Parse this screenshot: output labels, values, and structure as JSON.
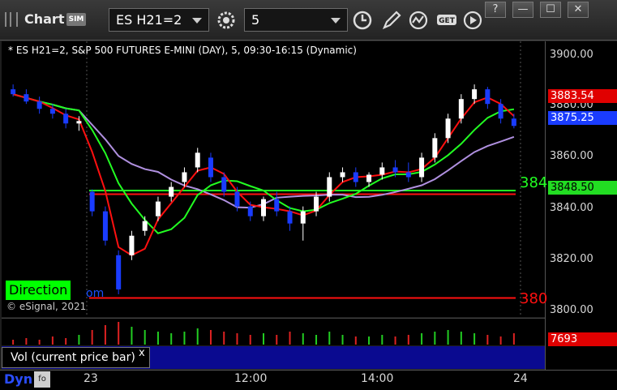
{
  "toolbar": {
    "app_title": "Chart",
    "sim_badge": "SIM",
    "symbol": "ES H21=2",
    "interval": "5",
    "window_buttons": [
      "?",
      "—",
      "☐",
      "✕"
    ]
  },
  "chart": {
    "header": "* ES H21=2, S&P 500 FUTURES E-MINI (DAY), 5, 09:30-16:15 (Dynamic)",
    "copyright": "© eSignal, 2021",
    "direction_label": "Direction",
    "direction_suffix": "om",
    "price_ticks": [
      "3900.00",
      "3880.00",
      "3860.00",
      "3840.00",
      "3820.00",
      "3800.00"
    ],
    "price_tags": {
      "red": "3883.54",
      "blue": "3875.25",
      "green": "3848.50"
    },
    "side_labels": {
      "green": "384",
      "red": "380"
    },
    "colors": {
      "up_candle": "#ffffff",
      "down_candle": "#1a3cff",
      "ma_red": "#ff1010",
      "ma_green": "#22ff22",
      "ma_purple": "#b090e0",
      "level_green": "#22ff22",
      "level_red": "#ff1010",
      "volume_bg": "#0a0a90"
    }
  },
  "chart_data": {
    "type": "candlestick",
    "ylim": [
      3800,
      3905
    ],
    "yticks": [
      3900,
      3880,
      3860,
      3840,
      3820,
      3800
    ],
    "xticks": [
      "23",
      "12:00",
      "14:00",
      "24"
    ],
    "levels": [
      {
        "value": 3848.5,
        "color": "green"
      },
      {
        "value": 3847.0,
        "color": "red"
      },
      {
        "value": 3804.5,
        "color": "red"
      }
    ],
    "candles": [
      {
        "o": 3890,
        "h": 3892,
        "l": 3887,
        "c": 3888
      },
      {
        "o": 3888,
        "h": 3890,
        "l": 3884,
        "c": 3885
      },
      {
        "o": 3885,
        "h": 3887,
        "l": 3880,
        "c": 3882
      },
      {
        "o": 3882,
        "h": 3884,
        "l": 3878,
        "c": 3880
      },
      {
        "o": 3880,
        "h": 3882,
        "l": 3874,
        "c": 3876
      },
      {
        "o": 3876,
        "h": 3879,
        "l": 3873,
        "c": 3877
      },
      {
        "o": 3848,
        "h": 3849,
        "l": 3838,
        "c": 3840
      },
      {
        "o": 3840,
        "h": 3842,
        "l": 3826,
        "c": 3828
      },
      {
        "o": 3822,
        "h": 3824,
        "l": 3806,
        "c": 3808
      },
      {
        "o": 3822,
        "h": 3832,
        "l": 3820,
        "c": 3830
      },
      {
        "o": 3832,
        "h": 3838,
        "l": 3830,
        "c": 3836
      },
      {
        "o": 3838,
        "h": 3846,
        "l": 3836,
        "c": 3844
      },
      {
        "o": 3846,
        "h": 3852,
        "l": 3844,
        "c": 3850
      },
      {
        "o": 3852,
        "h": 3858,
        "l": 3850,
        "c": 3856
      },
      {
        "o": 3858,
        "h": 3866,
        "l": 3856,
        "c": 3864
      },
      {
        "o": 3862,
        "h": 3864,
        "l": 3852,
        "c": 3854
      },
      {
        "o": 3854,
        "h": 3856,
        "l": 3846,
        "c": 3848
      },
      {
        "o": 3848,
        "h": 3850,
        "l": 3840,
        "c": 3842
      },
      {
        "o": 3842,
        "h": 3844,
        "l": 3836,
        "c": 3838
      },
      {
        "o": 3838,
        "h": 3846,
        "l": 3836,
        "c": 3845
      },
      {
        "o": 3845,
        "h": 3848,
        "l": 3838,
        "c": 3840
      },
      {
        "o": 3840,
        "h": 3842,
        "l": 3832,
        "c": 3835
      },
      {
        "o": 3835,
        "h": 3842,
        "l": 3828,
        "c": 3840
      },
      {
        "o": 3840,
        "h": 3848,
        "l": 3838,
        "c": 3846
      },
      {
        "o": 3846,
        "h": 3856,
        "l": 3844,
        "c": 3854
      },
      {
        "o": 3854,
        "h": 3858,
        "l": 3852,
        "c": 3856
      },
      {
        "o": 3856,
        "h": 3858,
        "l": 3850,
        "c": 3852
      },
      {
        "o": 3852,
        "h": 3856,
        "l": 3850,
        "c": 3855
      },
      {
        "o": 3855,
        "h": 3860,
        "l": 3853,
        "c": 3858
      },
      {
        "o": 3858,
        "h": 3861,
        "l": 3854,
        "c": 3856
      },
      {
        "o": 3856,
        "h": 3860,
        "l": 3852,
        "c": 3854
      },
      {
        "o": 3854,
        "h": 3864,
        "l": 3852,
        "c": 3862
      },
      {
        "o": 3862,
        "h": 3872,
        "l": 3860,
        "c": 3870
      },
      {
        "o": 3870,
        "h": 3880,
        "l": 3868,
        "c": 3878
      },
      {
        "o": 3878,
        "h": 3888,
        "l": 3876,
        "c": 3886
      },
      {
        "o": 3886,
        "h": 3892,
        "l": 3884,
        "c": 3890
      },
      {
        "o": 3890,
        "h": 3891,
        "l": 3882,
        "c": 3884
      },
      {
        "o": 3884,
        "h": 3886,
        "l": 3876,
        "c": 3878
      },
      {
        "o": 3878,
        "h": 3880,
        "l": 3874,
        "c": 3875
      }
    ],
    "volume": [
      3,
      4,
      3,
      5,
      4,
      6,
      9,
      12,
      14,
      11,
      9,
      8,
      7,
      8,
      10,
      9,
      8,
      7,
      6,
      7,
      6,
      8,
      7,
      6,
      8,
      6,
      5,
      5,
      6,
      5,
      6,
      7,
      8,
      9,
      8,
      7,
      6,
      5,
      7
    ]
  },
  "volume_pane": {
    "label": "Vol (current price bar)",
    "close": "x",
    "value": "7693"
  },
  "time_axis": {
    "dyn_label": "Dyn",
    "dyn_icon": "fo",
    "labels": [
      "23",
      "12:00",
      "14:00",
      "24"
    ]
  }
}
